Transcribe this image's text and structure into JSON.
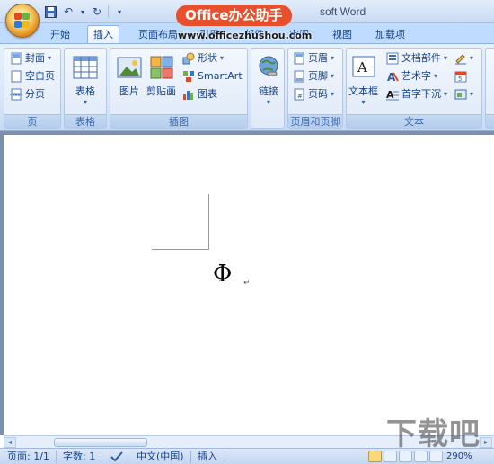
{
  "titlebar": {
    "app_title": "soft Word",
    "watermark_badge": "Office办公助手",
    "watermark_url": "www.officezhushou.com",
    "qat_icons": [
      "save-icon",
      "undo-icon",
      "redo-icon",
      "customize-icon"
    ]
  },
  "tabs": [
    {
      "label": "开始"
    },
    {
      "label": "插入",
      "active": true
    },
    {
      "label": "页面布局"
    },
    {
      "label": "引用"
    },
    {
      "label": "邮件"
    },
    {
      "label": "审阅"
    },
    {
      "label": "视图"
    },
    {
      "label": "加载项"
    }
  ],
  "ribbon": {
    "pages": {
      "label": "页",
      "cover": "封面",
      "blank": "空白页",
      "break": "分页"
    },
    "table": {
      "label": "表格",
      "table": "表格"
    },
    "illustrations": {
      "label": "插图",
      "picture": "图片",
      "clipart": "剪贴画",
      "shapes": "形状",
      "smartart": "SmartArt",
      "chart": "图表"
    },
    "links": {
      "link": "链接"
    },
    "header_footer": {
      "label": "页眉和页脚",
      "header": "页眉",
      "footer": "页脚",
      "page_number": "页码"
    },
    "text": {
      "label": "文本",
      "textbox": "文本框",
      "quickparts": "文档部件",
      "wordart": "艺术字",
      "dropcap": "首字下沉"
    }
  },
  "document": {
    "symbol": "Φ",
    "para_mark": "↵"
  },
  "statusbar": {
    "page": "页面: 1/1",
    "words": "字数: 1",
    "language": "中文(中国)",
    "mode": "插入",
    "zoom": "290%"
  },
  "site_logo": "下载吧",
  "colors": {
    "ribbon_bg": "#dbe7f8",
    "tab_bg": "#bfdbff",
    "text": "#15428b",
    "watermark": "#e8502c"
  }
}
